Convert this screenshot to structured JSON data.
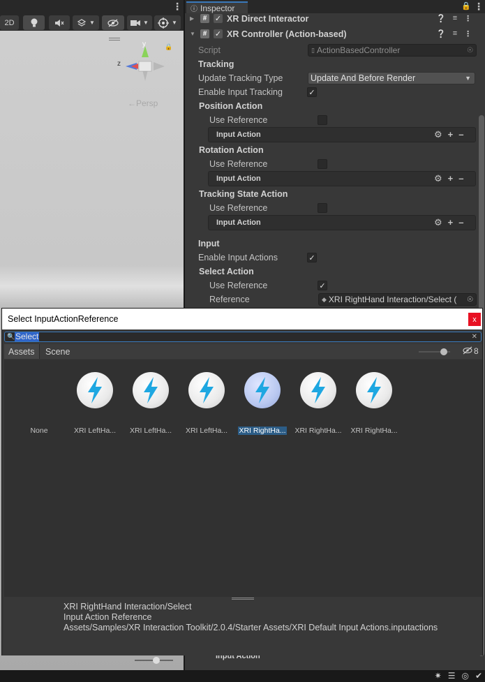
{
  "scene": {
    "toolbar": {
      "mode_2d": "2D",
      "light_icon": "lightbulb-icon",
      "audio_icon": "audio-mute-icon",
      "effects_icon": "effects-icon",
      "hidden_icon": "visibility-icon",
      "camera_icon": "camera-icon",
      "gizmos_icon": "gizmo-icon"
    },
    "gizmo": {
      "y": "y",
      "z": "z"
    },
    "projection_label": "←Persp"
  },
  "inspector": {
    "tab_label": "Inspector",
    "components": [
      {
        "name": "XR Direct Interactor",
        "enabled": true
      },
      {
        "name": "XR Controller (Action-based)",
        "enabled": true
      }
    ],
    "script_label": "Script",
    "script_value": "ActionBasedController",
    "tracking_header": "Tracking",
    "update_tracking_type_label": "Update Tracking Type",
    "update_tracking_type_value": "Update And Before Render",
    "enable_input_tracking_label": "Enable Input Tracking",
    "enable_input_tracking": true,
    "position_action": {
      "header": "Position Action",
      "use_reference_label": "Use Reference",
      "use_reference": false,
      "input_action_label": "Input Action"
    },
    "rotation_action": {
      "header": "Rotation Action",
      "use_reference_label": "Use Reference",
      "use_reference": false,
      "input_action_label": "Input Action"
    },
    "tracking_state_action": {
      "header": "Tracking State Action",
      "use_reference_label": "Use Reference",
      "use_reference": false,
      "input_action_label": "Input Action"
    },
    "input_header": "Input",
    "enable_input_actions_label": "Enable Input Actions",
    "enable_input_actions": true,
    "select_action": {
      "header": "Select Action",
      "use_reference_label": "Use Reference",
      "use_reference": true,
      "reference_label": "Reference",
      "reference_value": "XRI RightHand Interaction/Select ("
    },
    "bottom_input_action_label": "Input Action"
  },
  "popup": {
    "title": "Select InputActionReference",
    "close_label": "x",
    "search_value": "Select",
    "tabs": [
      "Assets",
      "Scene"
    ],
    "visible_count": "8",
    "items": [
      {
        "label": "None",
        "has_icon": false,
        "selected": false
      },
      {
        "label": "XRI LeftHa...",
        "has_icon": true,
        "selected": false
      },
      {
        "label": "XRI LeftHa...",
        "has_icon": true,
        "selected": false
      },
      {
        "label": "XRI LeftHa...",
        "has_icon": true,
        "selected": false
      },
      {
        "label": "XRI RightHa...",
        "has_icon": true,
        "selected": true
      },
      {
        "label": "XRI RightHa...",
        "has_icon": true,
        "selected": false
      },
      {
        "label": "XRI RightHa...",
        "has_icon": true,
        "selected": false
      }
    ],
    "details": {
      "line1": "XRI RightHand Interaction/Select",
      "line2": "Input Action Reference",
      "line3": "Assets/Samples/XR Interaction Toolkit/2.0.4/Starter Assets/XRI Default Input Actions.inputactions"
    }
  },
  "colors": {
    "accent": "#3a79bb",
    "bolt": "#1ea7e1",
    "close": "#e81123",
    "selection": "#2c5d87"
  }
}
